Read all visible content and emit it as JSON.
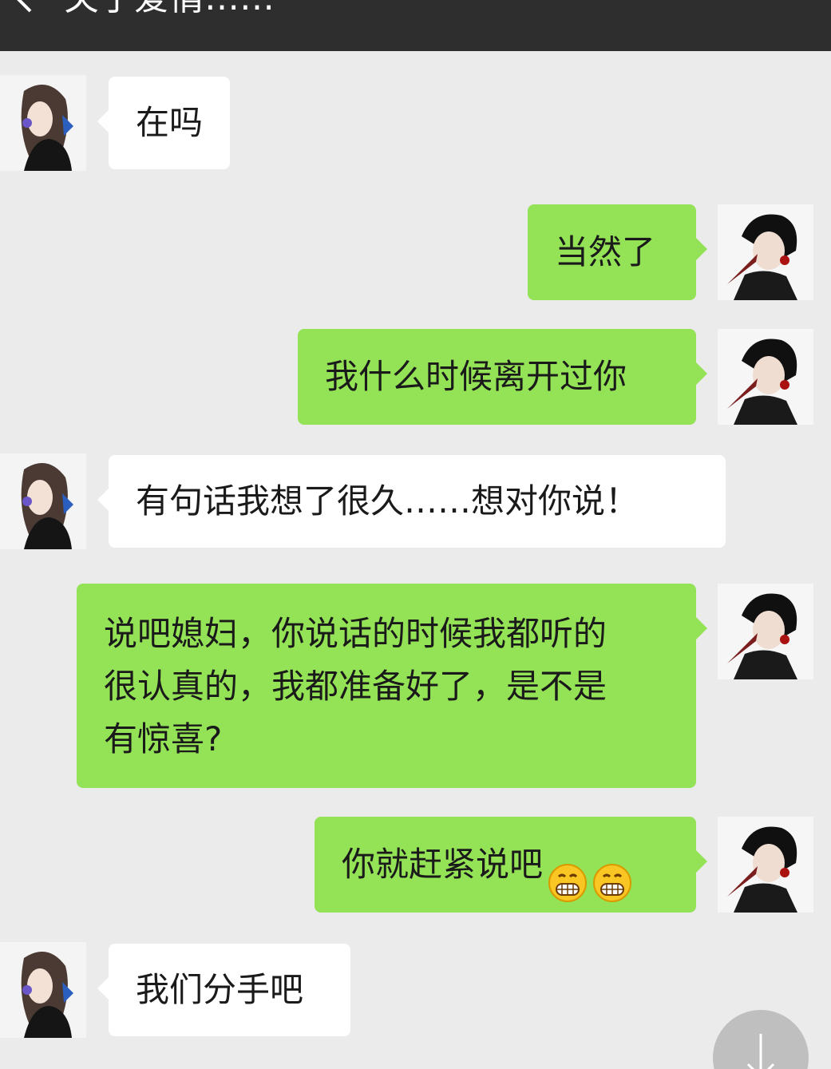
{
  "header": {
    "title": "关于爱情……",
    "back_icon": "chevron-left-icon"
  },
  "colors": {
    "titlebar": "#2e2e2e",
    "background": "#ebebeb",
    "incoming_bubble": "#ffffff",
    "outgoing_bubble": "#94e256"
  },
  "messages": [
    {
      "side": "left",
      "text": "在吗"
    },
    {
      "side": "right",
      "text": "当然了"
    },
    {
      "side": "right",
      "text": "我什么时候离开过你"
    },
    {
      "side": "left",
      "text": "有句话我想了很久……想对你说！"
    },
    {
      "side": "right",
      "lines": [
        "说吧媳妇，你说话的时候我都听的",
        "很认真的，我都准备好了，是不是",
        "有惊喜?"
      ]
    },
    {
      "side": "right",
      "text": "你就赶紧说吧",
      "emojis": [
        "grinning-emoji",
        "grinning-emoji"
      ]
    },
    {
      "side": "left",
      "text": "我们分手吧"
    }
  ],
  "scroll_button": {
    "icon": "arrow-down-icon"
  }
}
